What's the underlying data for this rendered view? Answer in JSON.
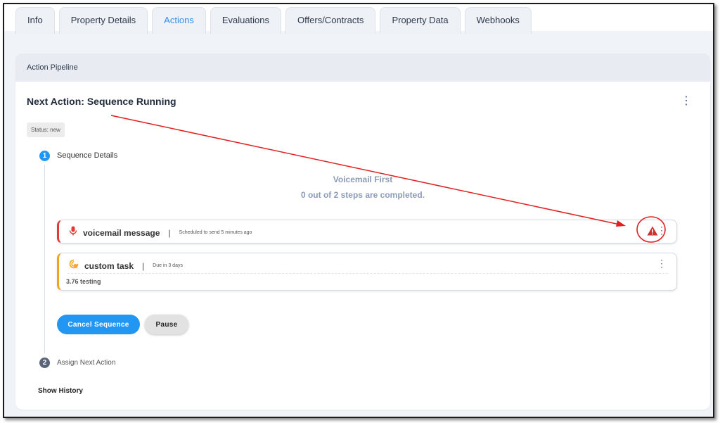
{
  "tabs": [
    {
      "label": "Info",
      "active": false
    },
    {
      "label": "Property Details",
      "active": false
    },
    {
      "label": "Actions",
      "active": true
    },
    {
      "label": "Evaluations",
      "active": false
    },
    {
      "label": "Offers/Contracts",
      "active": false
    },
    {
      "label": "Property Data",
      "active": false
    },
    {
      "label": "Webhooks",
      "active": false
    }
  ],
  "panel": {
    "header": "Action Pipeline",
    "title": "Next Action: Sequence Running",
    "status": "Status: new",
    "steps": [
      {
        "number": "1",
        "label": "Sequence Details"
      },
      {
        "number": "2",
        "label": "Assign Next Action"
      }
    ],
    "sequence": {
      "name": "Voicemail First",
      "progress_text": "0 out of 2 steps are completed.",
      "completed": 0,
      "total": 2
    },
    "cards": [
      {
        "icon": "microphone-icon",
        "title": "voicemail message",
        "separator": "|",
        "subtitle": "Scheduled to send 5 minutes ago",
        "accent": "#e53935",
        "warning": true
      },
      {
        "icon": "target-cursor-icon",
        "title": "custom task",
        "separator": "|",
        "subtitle": "Due in 3 days",
        "accent": "#f2a31c",
        "body": "3.76 testing"
      }
    ],
    "buttons": {
      "cancel": "Cancel Sequence",
      "pause": "Pause"
    },
    "show_history": "Show History"
  },
  "colors": {
    "accent": "#2196f3",
    "active_tab": "#3b8ee8",
    "annotation": "#e02020"
  }
}
